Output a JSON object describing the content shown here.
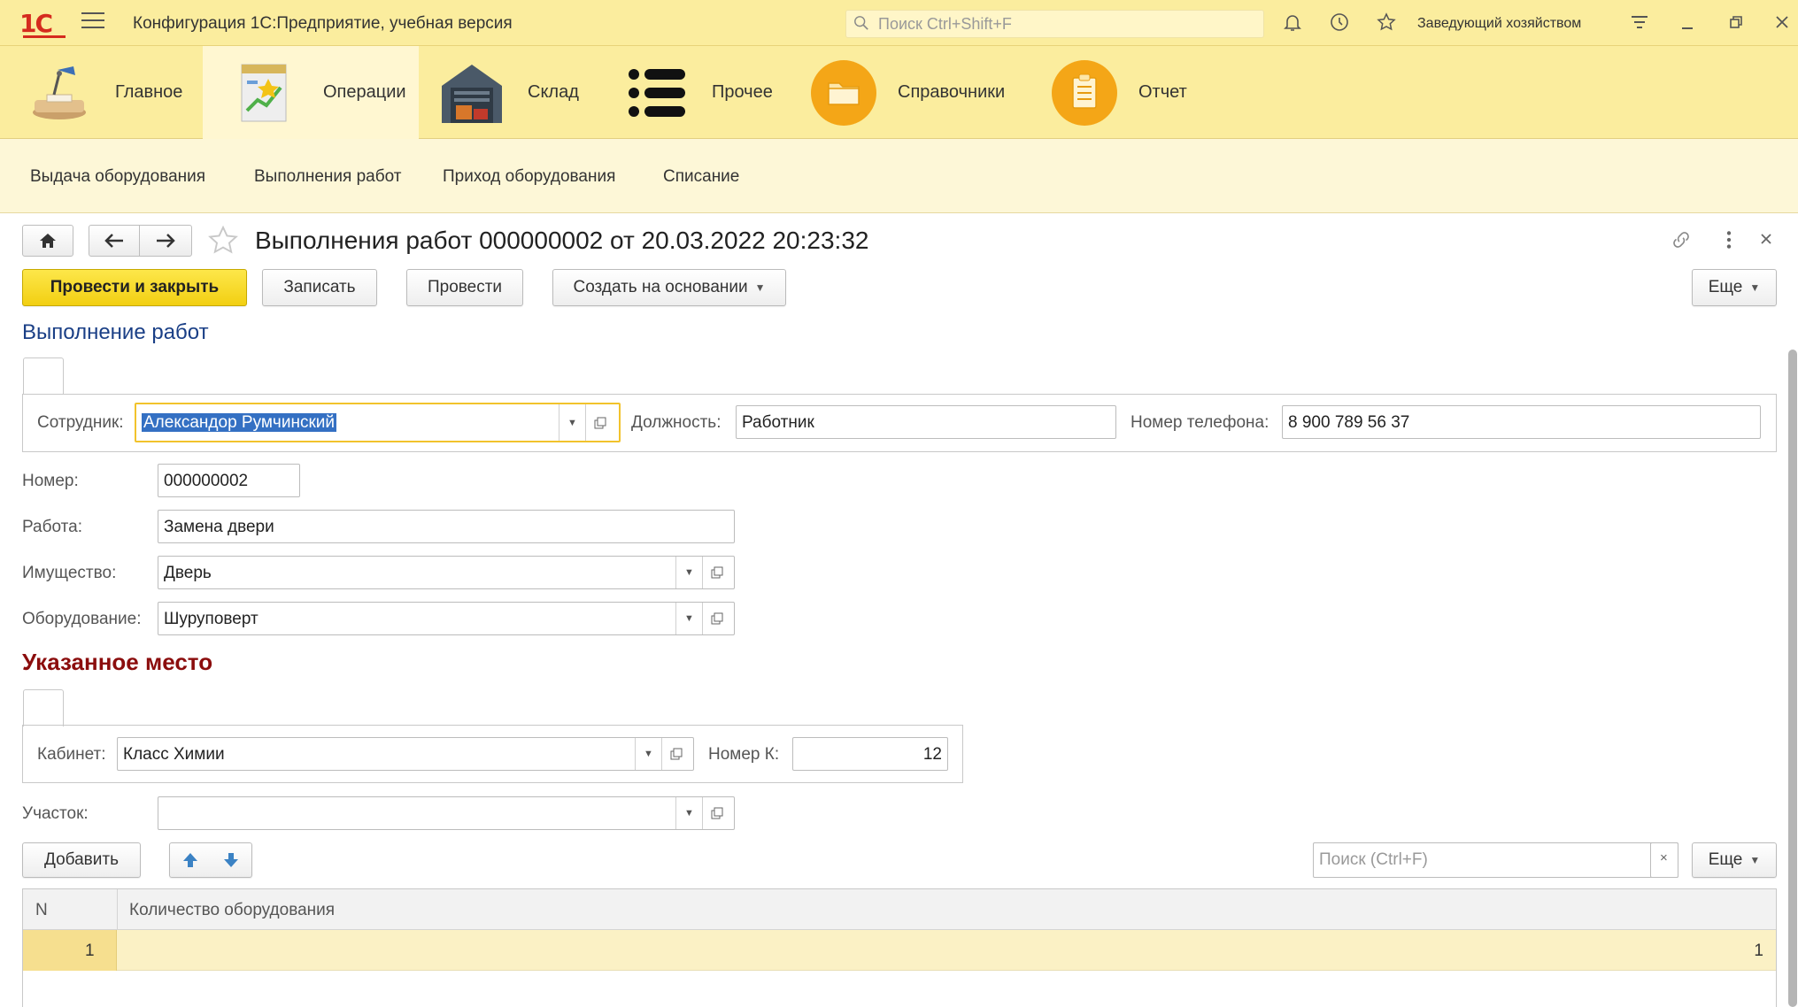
{
  "window": {
    "logo": "1С",
    "title": "Конфигурация 1С:Предприятие, учебная версия",
    "search_placeholder": "Поиск Ctrl+Shift+F",
    "user": "Заведующий хозяйством"
  },
  "sections": [
    {
      "label": "Главное"
    },
    {
      "label": "Операции"
    },
    {
      "label": "Склад"
    },
    {
      "label": "Прочее"
    },
    {
      "label": "Справочники"
    },
    {
      "label": "Отчет"
    }
  ],
  "navigation": [
    {
      "label": "Выдача оборудования"
    },
    {
      "label": "Выполнения работ"
    },
    {
      "label": "Приход оборудования"
    },
    {
      "label": "Списание"
    }
  ],
  "form": {
    "title": "Выполнения работ 000000002 от 20.03.2022 20:23:32",
    "buttons": {
      "post_close": "Провести и закрыть",
      "save": "Записать",
      "post": "Провести",
      "create_based": "Создать на основании",
      "more": "Еще"
    },
    "group1_title": "Выполнение работ",
    "employee_label": "Сотрудник:",
    "employee_value": "Александор Румчинский",
    "position_label": "Должность:",
    "position_value": "Работник",
    "phone_label": "Номер телефона:",
    "phone_value": "8 900 789 56 37",
    "number_label": "Номер:",
    "number_value": "000000002",
    "work_label": "Работа:",
    "work_value": "Замена двери",
    "property_label": "Имущество:",
    "property_value": "Дверь",
    "equipment_label": "Оборудование:",
    "equipment_value": "Шуруповерт",
    "group2_title": "Указанное место",
    "cabinet_label": "Кабинет:",
    "cabinet_value": "Класс Химии",
    "roomnum_label": "Номер К:",
    "roomnum_value": "12",
    "area_label": "Участок:",
    "area_value": ""
  },
  "table": {
    "add_button": "Добавить",
    "search_placeholder": "Поиск (Ctrl+F)",
    "more": "Еще",
    "columns": [
      "N",
      "Количество оборудования"
    ],
    "rows": [
      {
        "n": "1",
        "qty": "1"
      }
    ]
  },
  "colors": {
    "accent_yellow": "#fbed9e",
    "primary_button": "#f2cf12",
    "title_blue": "#1a3f86",
    "title_red": "#8b0d0d"
  }
}
